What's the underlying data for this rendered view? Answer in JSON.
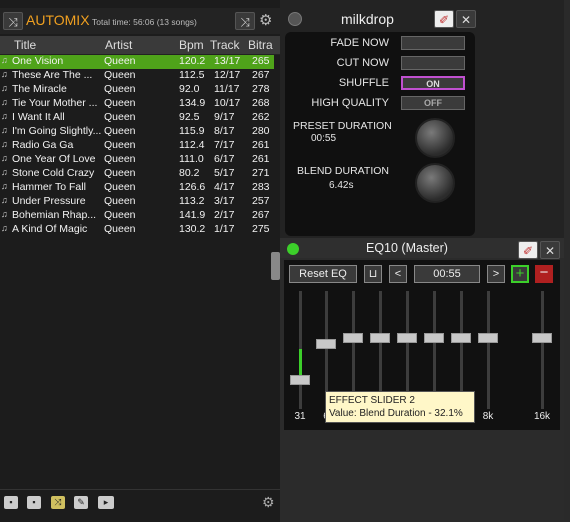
{
  "automix": {
    "title": "AUTOMIX",
    "total": "Total time: 56:06 (13 songs)",
    "columns": [
      "Title",
      "Artist",
      "Bpm",
      "Track",
      "Bitra"
    ],
    "rows": [
      {
        "title": "One Vision",
        "artist": "Queen",
        "bpm": "120.2",
        "track": "13/17",
        "bitrate": "265",
        "selected": true
      },
      {
        "title": "These Are The ...",
        "artist": "Queen",
        "bpm": "112.5",
        "track": "12/17",
        "bitrate": "267"
      },
      {
        "title": "The Miracle",
        "artist": "Queen",
        "bpm": "92.0",
        "track": "11/17",
        "bitrate": "278"
      },
      {
        "title": "Tie Your Mother ...",
        "artist": "Queen",
        "bpm": "134.9",
        "track": "10/17",
        "bitrate": "268"
      },
      {
        "title": "I Want It All",
        "artist": "Queen",
        "bpm": "92.5",
        "track": "9/17",
        "bitrate": "262"
      },
      {
        "title": "I'm Going Slightly...",
        "artist": "Queen",
        "bpm": "115.9",
        "track": "8/17",
        "bitrate": "280"
      },
      {
        "title": "Radio Ga Ga",
        "artist": "Queen",
        "bpm": "112.4",
        "track": "7/17",
        "bitrate": "261"
      },
      {
        "title": "One Year Of Love",
        "artist": "Queen",
        "bpm": "111.0",
        "track": "6/17",
        "bitrate": "261"
      },
      {
        "title": "Stone Cold Crazy",
        "artist": "Queen",
        "bpm": "80.2",
        "track": "5/17",
        "bitrate": "271"
      },
      {
        "title": "Hammer To Fall",
        "artist": "Queen",
        "bpm": "126.6",
        "track": "4/17",
        "bitrate": "283"
      },
      {
        "title": "Under Pressure",
        "artist": "Queen",
        "bpm": "113.2",
        "track": "3/17",
        "bitrate": "257"
      },
      {
        "title": "Bohemian Rhap...",
        "artist": "Queen",
        "bpm": "141.9",
        "track": "2/17",
        "bitrate": "267"
      },
      {
        "title": "A Kind Of Magic",
        "artist": "Queen",
        "bpm": "130.2",
        "track": "1/17",
        "bitrate": "275"
      }
    ]
  },
  "milkdrop": {
    "title": "milkdrop",
    "fade_now": "FADE NOW",
    "cut_now": "CUT NOW",
    "shuffle": "SHUFFLE",
    "shuffle_state": "ON",
    "high_quality": "HIGH QUALITY",
    "hq_state": "OFF",
    "preset_duration_label": "PRESET DURATION",
    "preset_duration": "00:55",
    "blend_duration_label": "BLEND DURATION",
    "blend_duration": "6.42s"
  },
  "eq": {
    "title": "EQ10 (Master)",
    "reset": "Reset EQ",
    "time": "00:55",
    "prev": "<",
    "next": ">",
    "bands": [
      "31",
      "6",
      "",
      "",
      "",
      "",
      "4k",
      "8k",
      "16k"
    ],
    "levels": [
      0.25,
      0.55,
      0.6,
      0.6,
      0.6,
      0.6,
      0.6,
      0.6,
      0.6
    ],
    "tooltip_title": "EFFECT SLIDER 2",
    "tooltip_value": "Value: Blend Duration - 32.1%"
  },
  "colors": {
    "accent": "#f0a020",
    "selected_row": "#4fa31a",
    "on": "#c050d0",
    "green": "#3ccf2a"
  }
}
